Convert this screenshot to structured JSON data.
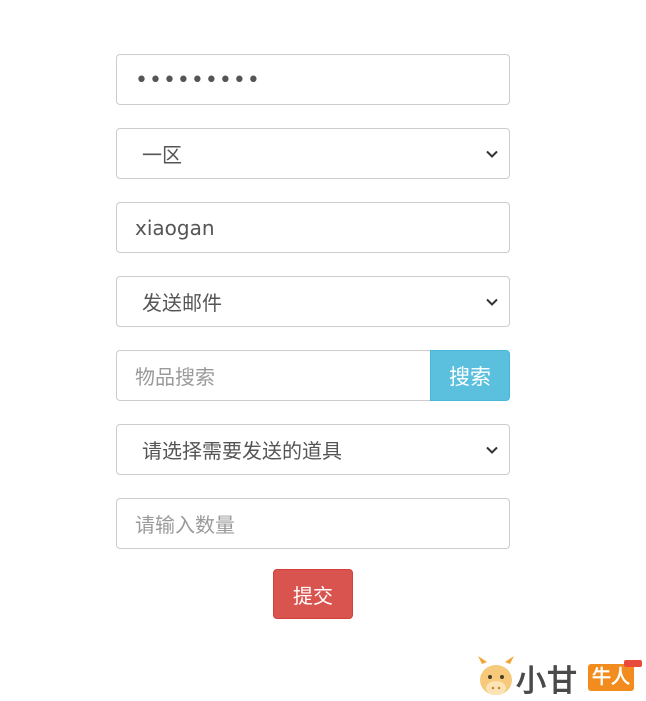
{
  "form": {
    "password_mask": "•••••••••",
    "server_select": "一区",
    "username": "xiaogan",
    "action_select": "发送邮件",
    "item_search_placeholder": "物品搜索",
    "search_button": "搜索",
    "item_select": "请选择需要发送的道具",
    "quantity_placeholder": "请输入数量",
    "submit_button": "提交"
  },
  "watermark": {
    "text": "小甘",
    "tag": "牛人"
  },
  "colors": {
    "search_button": "#5bc0de",
    "submit_button": "#d9534f",
    "border": "#cccccc",
    "logo_orange": "#f28c1e"
  },
  "icons": {
    "select_arrow": "chevron-down-icon",
    "logo": "cow-mascot-icon"
  }
}
